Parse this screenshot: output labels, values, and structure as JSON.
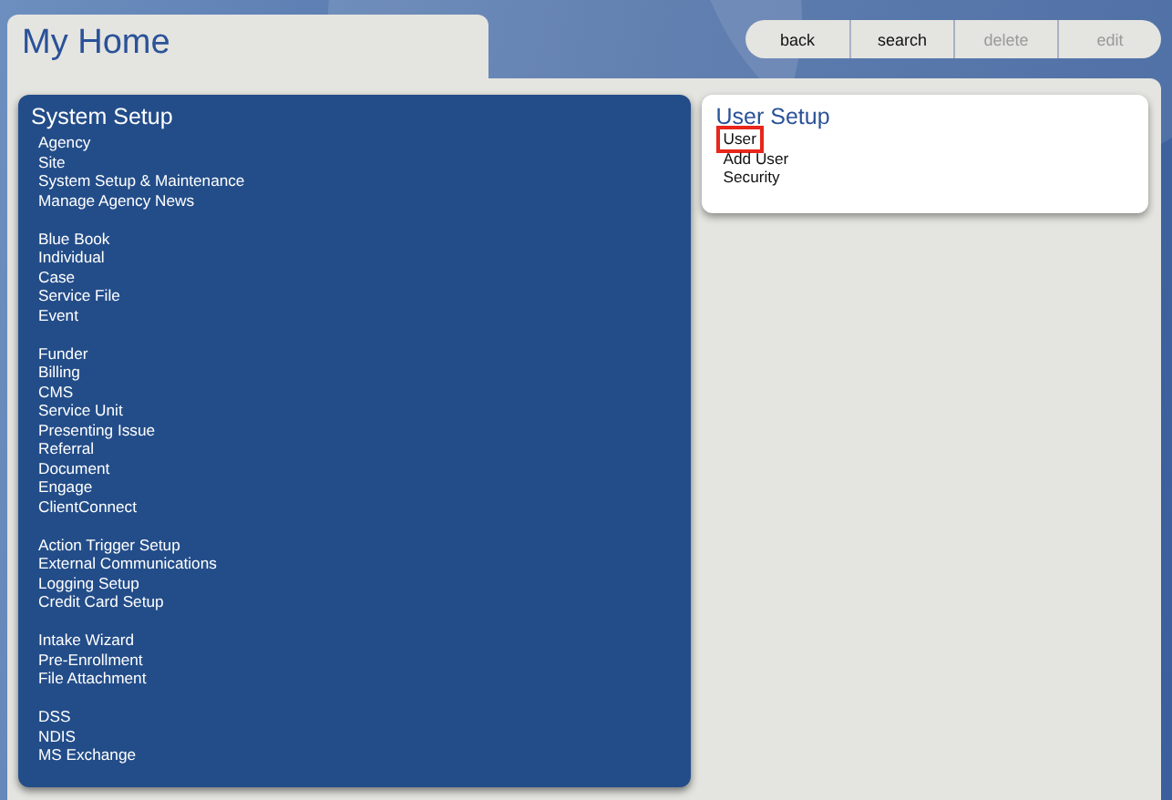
{
  "header": {
    "title": "My Home"
  },
  "toolbar": [
    {
      "label": "back",
      "disabled": false
    },
    {
      "label": "search",
      "disabled": false
    },
    {
      "label": "delete",
      "disabled": true
    },
    {
      "label": "edit",
      "disabled": true
    }
  ],
  "system_setup": {
    "title": "System Setup",
    "groups": [
      [
        "Agency",
        "Site",
        "System Setup & Maintenance",
        "Manage Agency News"
      ],
      [
        "Blue Book",
        "Individual",
        "Case",
        "Service File",
        "Event"
      ],
      [
        "Funder",
        "Billing",
        "CMS",
        "Service Unit",
        "Presenting Issue",
        "Referral",
        "Document",
        "Engage",
        "ClientConnect"
      ],
      [
        "Action Trigger Setup",
        "External Communications",
        "Logging Setup",
        "Credit Card Setup"
      ],
      [
        "Intake Wizard",
        "Pre-Enrollment",
        "File Attachment"
      ],
      [
        "DSS",
        "NDIS",
        "MS Exchange"
      ]
    ]
  },
  "user_setup": {
    "title": "User Setup",
    "items": [
      {
        "label": "User",
        "selected": true
      },
      {
        "label": "Add User",
        "selected": false
      },
      {
        "label": "Security",
        "selected": false
      }
    ]
  }
}
